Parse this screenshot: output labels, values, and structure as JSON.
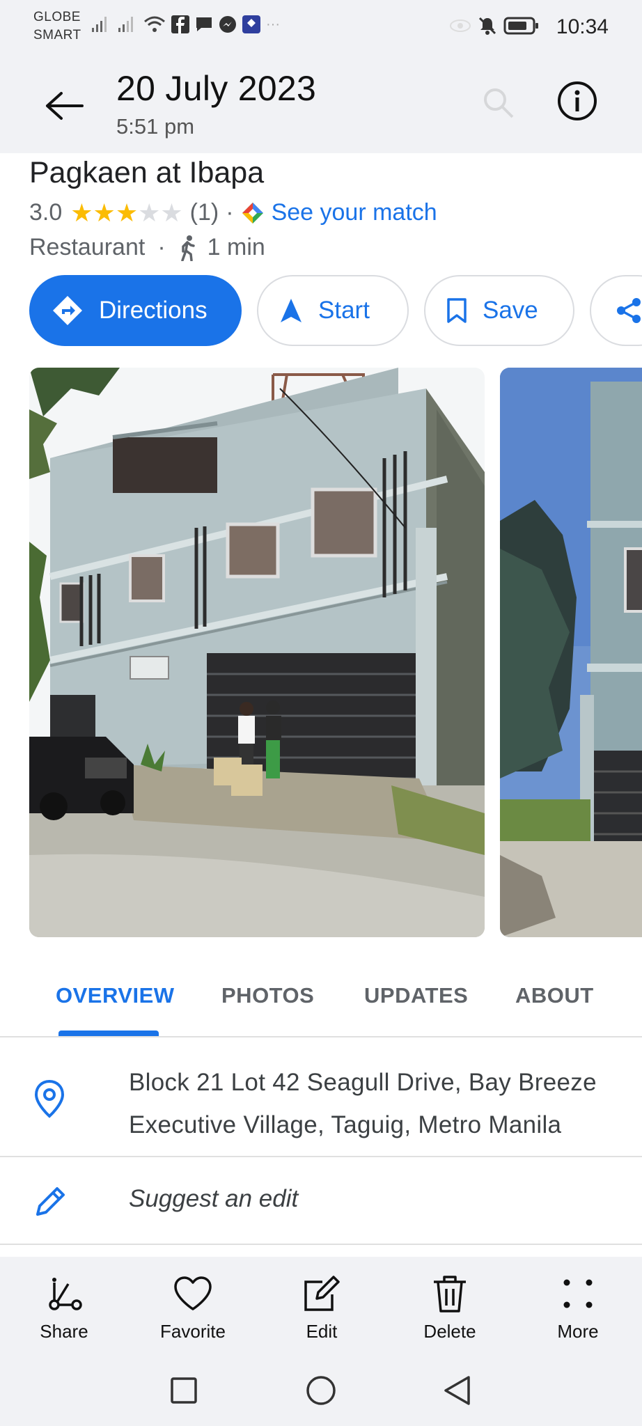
{
  "status_bar": {
    "carrier_1": "GLOBE",
    "carrier_2": "SMART",
    "time": "10:34"
  },
  "header": {
    "date": "20 July 2023",
    "time": "5:51 pm"
  },
  "place": {
    "name": "Pagkaen at Ibapa",
    "rating": "3.0",
    "stars_filled": 3,
    "stars_total": 5,
    "review_count": "(1)",
    "separator": "·",
    "match_label": "See your match",
    "category": "Restaurant",
    "walk_time": "1 min"
  },
  "actions": {
    "directions": "Directions",
    "start": "Start",
    "save": "Save"
  },
  "tabs": [
    "OVERVIEW",
    "PHOTOS",
    "UPDATES",
    "ABOUT"
  ],
  "address": {
    "line1": "Block 21 Lot 42 Seagull Drive, Bay Breeze",
    "line2": "Executive Village, Taguig, Metro Manila"
  },
  "suggest_edit": "Suggest an edit",
  "gallery_actions": {
    "share": "Share",
    "favorite": "Favorite",
    "edit": "Edit",
    "delete": "Delete",
    "more": "More"
  },
  "colors": {
    "accent": "#1a73e8",
    "star": "#fbbc04",
    "bar_bg": "#f1f2f5"
  }
}
